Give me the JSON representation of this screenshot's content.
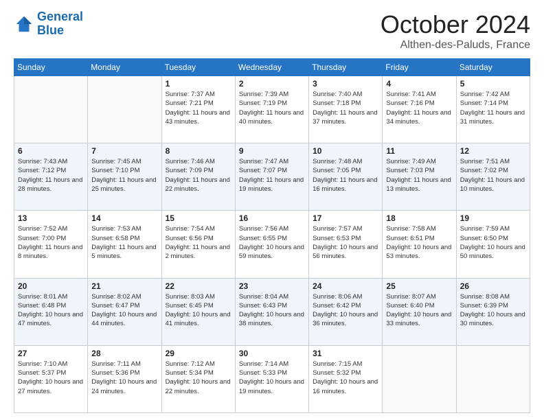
{
  "logo": {
    "line1": "General",
    "line2": "Blue"
  },
  "title": "October 2024",
  "subtitle": "Althen-des-Paluds, France",
  "days_of_week": [
    "Sunday",
    "Monday",
    "Tuesday",
    "Wednesday",
    "Thursday",
    "Friday",
    "Saturday"
  ],
  "weeks": [
    [
      {
        "day": "",
        "sunrise": "",
        "sunset": "",
        "daylight": ""
      },
      {
        "day": "",
        "sunrise": "",
        "sunset": "",
        "daylight": ""
      },
      {
        "day": "1",
        "sunrise": "Sunrise: 7:37 AM",
        "sunset": "Sunset: 7:21 PM",
        "daylight": "Daylight: 11 hours and 43 minutes."
      },
      {
        "day": "2",
        "sunrise": "Sunrise: 7:39 AM",
        "sunset": "Sunset: 7:19 PM",
        "daylight": "Daylight: 11 hours and 40 minutes."
      },
      {
        "day": "3",
        "sunrise": "Sunrise: 7:40 AM",
        "sunset": "Sunset: 7:18 PM",
        "daylight": "Daylight: 11 hours and 37 minutes."
      },
      {
        "day": "4",
        "sunrise": "Sunrise: 7:41 AM",
        "sunset": "Sunset: 7:16 PM",
        "daylight": "Daylight: 11 hours and 34 minutes."
      },
      {
        "day": "5",
        "sunrise": "Sunrise: 7:42 AM",
        "sunset": "Sunset: 7:14 PM",
        "daylight": "Daylight: 11 hours and 31 minutes."
      }
    ],
    [
      {
        "day": "6",
        "sunrise": "Sunrise: 7:43 AM",
        "sunset": "Sunset: 7:12 PM",
        "daylight": "Daylight: 11 hours and 28 minutes."
      },
      {
        "day": "7",
        "sunrise": "Sunrise: 7:45 AM",
        "sunset": "Sunset: 7:10 PM",
        "daylight": "Daylight: 11 hours and 25 minutes."
      },
      {
        "day": "8",
        "sunrise": "Sunrise: 7:46 AM",
        "sunset": "Sunset: 7:09 PM",
        "daylight": "Daylight: 11 hours and 22 minutes."
      },
      {
        "day": "9",
        "sunrise": "Sunrise: 7:47 AM",
        "sunset": "Sunset: 7:07 PM",
        "daylight": "Daylight: 11 hours and 19 minutes."
      },
      {
        "day": "10",
        "sunrise": "Sunrise: 7:48 AM",
        "sunset": "Sunset: 7:05 PM",
        "daylight": "Daylight: 11 hours and 16 minutes."
      },
      {
        "day": "11",
        "sunrise": "Sunrise: 7:49 AM",
        "sunset": "Sunset: 7:03 PM",
        "daylight": "Daylight: 11 hours and 13 minutes."
      },
      {
        "day": "12",
        "sunrise": "Sunrise: 7:51 AM",
        "sunset": "Sunset: 7:02 PM",
        "daylight": "Daylight: 11 hours and 10 minutes."
      }
    ],
    [
      {
        "day": "13",
        "sunrise": "Sunrise: 7:52 AM",
        "sunset": "Sunset: 7:00 PM",
        "daylight": "Daylight: 11 hours and 8 minutes."
      },
      {
        "day": "14",
        "sunrise": "Sunrise: 7:53 AM",
        "sunset": "Sunset: 6:58 PM",
        "daylight": "Daylight: 11 hours and 5 minutes."
      },
      {
        "day": "15",
        "sunrise": "Sunrise: 7:54 AM",
        "sunset": "Sunset: 6:56 PM",
        "daylight": "Daylight: 11 hours and 2 minutes."
      },
      {
        "day": "16",
        "sunrise": "Sunrise: 7:56 AM",
        "sunset": "Sunset: 6:55 PM",
        "daylight": "Daylight: 10 hours and 59 minutes."
      },
      {
        "day": "17",
        "sunrise": "Sunrise: 7:57 AM",
        "sunset": "Sunset: 6:53 PM",
        "daylight": "Daylight: 10 hours and 56 minutes."
      },
      {
        "day": "18",
        "sunrise": "Sunrise: 7:58 AM",
        "sunset": "Sunset: 6:51 PM",
        "daylight": "Daylight: 10 hours and 53 minutes."
      },
      {
        "day": "19",
        "sunrise": "Sunrise: 7:59 AM",
        "sunset": "Sunset: 6:50 PM",
        "daylight": "Daylight: 10 hours and 50 minutes."
      }
    ],
    [
      {
        "day": "20",
        "sunrise": "Sunrise: 8:01 AM",
        "sunset": "Sunset: 6:48 PM",
        "daylight": "Daylight: 10 hours and 47 minutes."
      },
      {
        "day": "21",
        "sunrise": "Sunrise: 8:02 AM",
        "sunset": "Sunset: 6:47 PM",
        "daylight": "Daylight: 10 hours and 44 minutes."
      },
      {
        "day": "22",
        "sunrise": "Sunrise: 8:03 AM",
        "sunset": "Sunset: 6:45 PM",
        "daylight": "Daylight: 10 hours and 41 minutes."
      },
      {
        "day": "23",
        "sunrise": "Sunrise: 8:04 AM",
        "sunset": "Sunset: 6:43 PM",
        "daylight": "Daylight: 10 hours and 38 minutes."
      },
      {
        "day": "24",
        "sunrise": "Sunrise: 8:06 AM",
        "sunset": "Sunset: 6:42 PM",
        "daylight": "Daylight: 10 hours and 36 minutes."
      },
      {
        "day": "25",
        "sunrise": "Sunrise: 8:07 AM",
        "sunset": "Sunset: 6:40 PM",
        "daylight": "Daylight: 10 hours and 33 minutes."
      },
      {
        "day": "26",
        "sunrise": "Sunrise: 8:08 AM",
        "sunset": "Sunset: 6:39 PM",
        "daylight": "Daylight: 10 hours and 30 minutes."
      }
    ],
    [
      {
        "day": "27",
        "sunrise": "Sunrise: 7:10 AM",
        "sunset": "Sunset: 5:37 PM",
        "daylight": "Daylight: 10 hours and 27 minutes."
      },
      {
        "day": "28",
        "sunrise": "Sunrise: 7:11 AM",
        "sunset": "Sunset: 5:36 PM",
        "daylight": "Daylight: 10 hours and 24 minutes."
      },
      {
        "day": "29",
        "sunrise": "Sunrise: 7:12 AM",
        "sunset": "Sunset: 5:34 PM",
        "daylight": "Daylight: 10 hours and 22 minutes."
      },
      {
        "day": "30",
        "sunrise": "Sunrise: 7:14 AM",
        "sunset": "Sunset: 5:33 PM",
        "daylight": "Daylight: 10 hours and 19 minutes."
      },
      {
        "day": "31",
        "sunrise": "Sunrise: 7:15 AM",
        "sunset": "Sunset: 5:32 PM",
        "daylight": "Daylight: 10 hours and 16 minutes."
      },
      {
        "day": "",
        "sunrise": "",
        "sunset": "",
        "daylight": ""
      },
      {
        "day": "",
        "sunrise": "",
        "sunset": "",
        "daylight": ""
      }
    ]
  ]
}
